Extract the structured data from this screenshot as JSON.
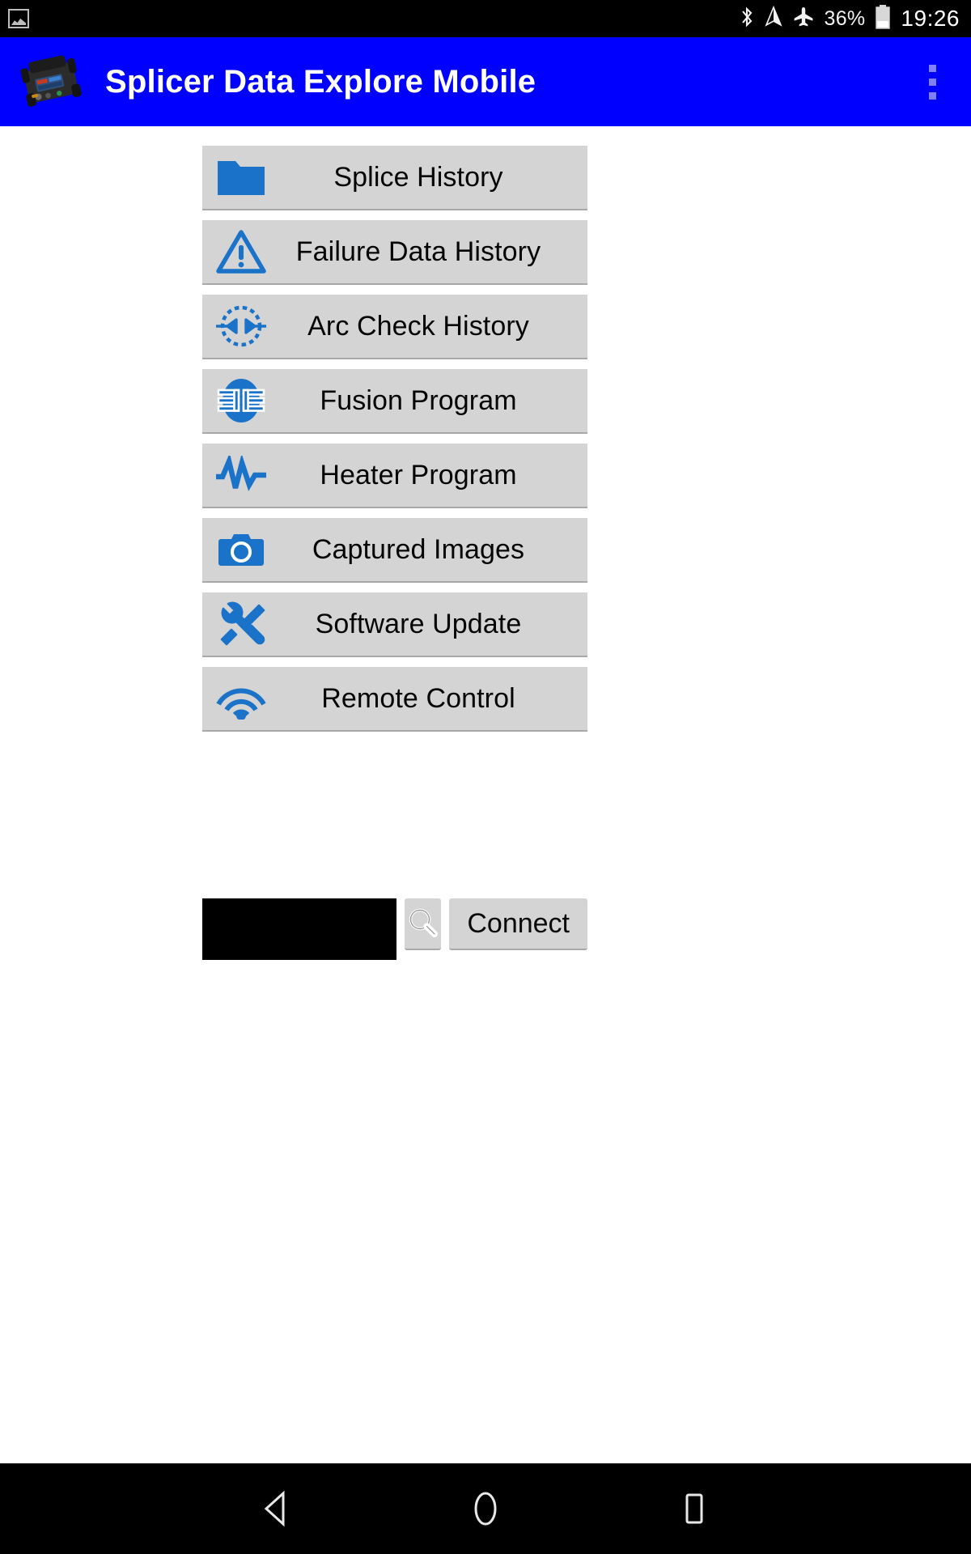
{
  "status_bar": {
    "left_icon": "screenshot-image-icon",
    "icons": [
      "bluetooth-icon",
      "location-icon",
      "airplane-mode-icon"
    ],
    "battery_percent": "36%",
    "battery_icon": "battery-icon",
    "clock": "19:26"
  },
  "app_bar": {
    "logo": "fusion-splicer-logo",
    "title": "Splicer Data Explore Mobile",
    "overflow": "overflow-menu-icon",
    "background_color": "#0000ff",
    "title_color": "#ffffff"
  },
  "menu": {
    "accent_color": "#1a73c8",
    "button_color": "#d4d4d4",
    "items": [
      {
        "label": "Splice History",
        "icon": "folder-icon"
      },
      {
        "label": "Failure Data History",
        "icon": "warning-triangle-icon"
      },
      {
        "label": "Arc Check History",
        "icon": "arc-electrodes-icon"
      },
      {
        "label": "Fusion Program",
        "icon": "fusion-program-icon"
      },
      {
        "label": "Heater Program",
        "icon": "waveform-icon"
      },
      {
        "label": "Captured Images",
        "icon": "camera-icon"
      },
      {
        "label": "Software Update",
        "icon": "tools-icon"
      },
      {
        "label": "Remote Control",
        "icon": "wifi-icon"
      }
    ]
  },
  "connect_row": {
    "device_field_value": "",
    "device_field_placeholder": "",
    "search_icon": "magnifier-search-icon",
    "connect_label": "Connect"
  },
  "nav_bar": {
    "back": "back-triangle-icon",
    "home": "home-circle-icon",
    "recents": "recents-square-icon"
  }
}
